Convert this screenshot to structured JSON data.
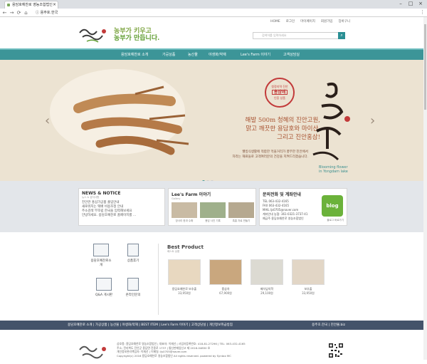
{
  "browser": {
    "tab_title": "용담호예찬로 영농조합법인",
    "url": "용주호.한국"
  },
  "toplinks": [
    "HOME",
    "로그인",
    "마이페이지",
    "회원가입",
    "장바구니"
  ],
  "slogan": {
    "line1": "농부가 키우고",
    "line2": "농부가 만듭니다."
  },
  "search": {
    "placeholder": "검색어를 입력하세요"
  },
  "gnb": [
    "용담호예찬로 소개",
    "가공상품",
    "농산물",
    "야생화/약재",
    "Lee's Farm 이야기",
    "고객상담실"
  ],
  "hero": {
    "headline1": "해발 500m 청혜의 진안고원,",
    "headline2": "맑고 깨끗한 용담호와 마이산,",
    "headline3": "그리고 진안홍삼!",
    "body1": "웰빙식생활에 적합한 먹을거리가 풍부한 진안에서",
    "body2": "자라는 재료들로 고객여러분의 건강을 지켜드리겠습니다.",
    "stamp_top": "청정지역 진안",
    "stamp_mid": "홍삼애",
    "stamp_bot": "인증 상품",
    "callig": "용담호 핀꽃",
    "callig_sub1": "Blooming flower",
    "callig_sub2": "in Yongdam lake",
    "arrow_left": "‹",
    "arrow_right": "›"
  },
  "news": {
    "title": "NEWS & NOTICE",
    "sub": "뉴스 & 공지사항",
    "items": [
      "진안관 홍삼가공품 출입안내",
      "새로워지는 택배 비용조정 안내",
      "주소검색 부조립 한국을 입력해보세요",
      "안녕하세요. 용담호예찬로 홈페이지를 ..."
    ]
  },
  "lee": {
    "title": "Lee's Farm 이야기",
    "sub": "Gallery",
    "captions": [
      "장사리 한과 수확",
      "용담 사진 기록",
      "흑홍 자료 만들기"
    ]
  },
  "contact": {
    "title": "문의전화 및 계좌안내",
    "rows": [
      "TEL       063-432-4165",
      "FAX       063-432-4165",
      "MAIL      ljs0705@naver.com",
      "계좌안내  농협: 361-0321-3737-41",
      "예금주    용담호예찬로 영농조합법인"
    ],
    "blog_label": "blog",
    "blog_caption": "블로그 바로가기"
  },
  "quick": [
    {
      "label": "용담호예찬로소개"
    },
    {
      "label": "상품후기"
    },
    {
      "label": "Q&A 게시판"
    },
    {
      "label": "온라인문의"
    }
  ],
  "best": {
    "title": "Best Product",
    "sub": "베스트 상품",
    "products": [
      {
        "name": "용담호예찬로 보추출",
        "price": "33,950원"
      },
      {
        "name": "흥삼차",
        "price": "67,900원"
      },
      {
        "name": "패치잎의학",
        "price": "29,100원"
      },
      {
        "name": "보추출",
        "price": "33,950원"
      }
    ]
  },
  "footer_nav": {
    "links": "용담호예찬로 소개 | 가공상품 | 농산물 | 야생화/약재 | BEST ITEM | Lee's Farm 이야기 | 고객상담실 | 개인정보취급방침",
    "right": "용주호.한국 | 진안몰.biz"
  },
  "footer": {
    "lines": [
      "상호명: 용담호예찬로 영농조합법인 | 대표자: 이재선 | 사업자등록번호: 418-81-27296 | TEL: 063-432-4165",
      "주소: 전라북도 진안군 용담면 진용로 1737 | 통신판매업신고 제 2016-04850 호",
      "개인정보관리책임자: 이재선 | 이메일: ljs0705@naver.com",
      "Copyright(c) 2016 용담호예찬로 영농조합법인 All rights reserved. powered by Syntax MC"
    ]
  }
}
